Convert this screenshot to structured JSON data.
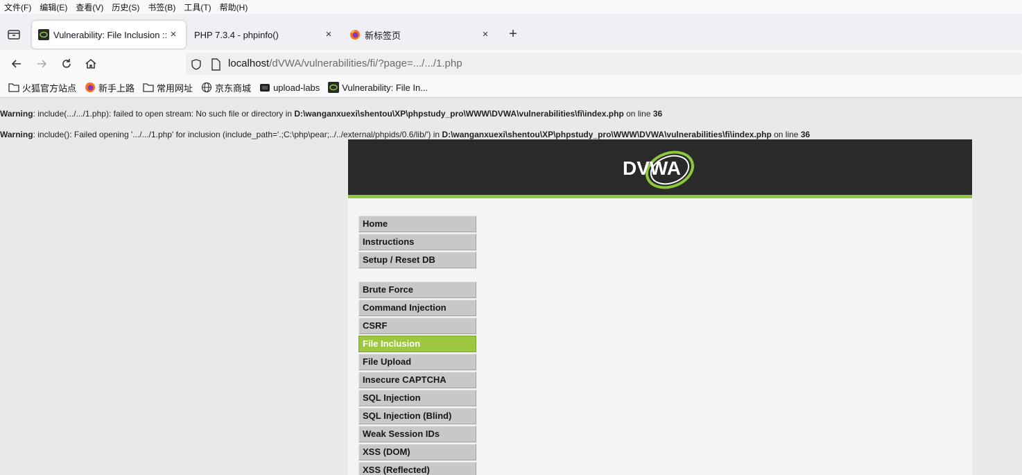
{
  "menubar": [
    "文件(F)",
    "编辑(E)",
    "查看(V)",
    "历史(S)",
    "书签(B)",
    "工具(T)",
    "帮助(H)"
  ],
  "tabs": [
    {
      "title": "Vulnerability: File Inclusion :: ",
      "active": true,
      "icon": "dvwa-favicon"
    },
    {
      "title": "PHP 7.3.4 - phpinfo()",
      "active": false,
      "icon": "none"
    },
    {
      "title": "新标签页",
      "active": false,
      "icon": "firefox-icon"
    }
  ],
  "newtab_label": "+",
  "tab_close": "×",
  "url": {
    "host": "localhost",
    "path": "/dVWA/vulnerabilities/fi/?page=.../.../1.php"
  },
  "bookmarks": [
    {
      "label": "火狐官方站点",
      "icon": "folder-icon"
    },
    {
      "label": "新手上路",
      "icon": "firefox-icon"
    },
    {
      "label": "常用网址",
      "icon": "folder-icon"
    },
    {
      "label": "京东商城",
      "icon": "globe-icon"
    },
    {
      "label": "upload-labs",
      "icon": "dark-page-icon"
    },
    {
      "label": "Vulnerability: File In...",
      "icon": "dvwa-favicon"
    }
  ],
  "warnings": [
    {
      "label": "Warning",
      "text": ": include(.../.../1.php): failed to open stream: No such file or directory in ",
      "path": "D:\\wanganxuexi\\shentou\\XP\\phpstudy_pro\\WWW\\DVWA\\vulnerabilities\\fi\\index.php",
      "line_text": " on line ",
      "line": "36"
    },
    {
      "label": "Warning",
      "text": ": include(): Failed opening '.../.../1.php' for inclusion (include_path='.;C:\\php\\pear;../../external/phpids/0.6/lib/') in ",
      "path": "D:\\wanganxuexi\\shentou\\XP\\phpstudy_pro\\WWW\\DVWA\\vulnerabilities\\fi\\index.php",
      "line_text": " on line ",
      "line": "36"
    }
  ],
  "logo_text": "DVWA",
  "menu": {
    "group1": [
      "Home",
      "Instructions",
      "Setup / Reset DB"
    ],
    "group2": [
      "Brute Force",
      "Command Injection",
      "CSRF",
      "File Inclusion",
      "File Upload",
      "Insecure CAPTCHA",
      "SQL Injection",
      "SQL Injection (Blind)",
      "Weak Session IDs",
      "XSS (DOM)",
      "XSS (Reflected)"
    ],
    "selected": "File Inclusion"
  },
  "colors": {
    "accent": "#8dc63f",
    "selected": "#9cc73f",
    "header": "#2a2a29"
  }
}
